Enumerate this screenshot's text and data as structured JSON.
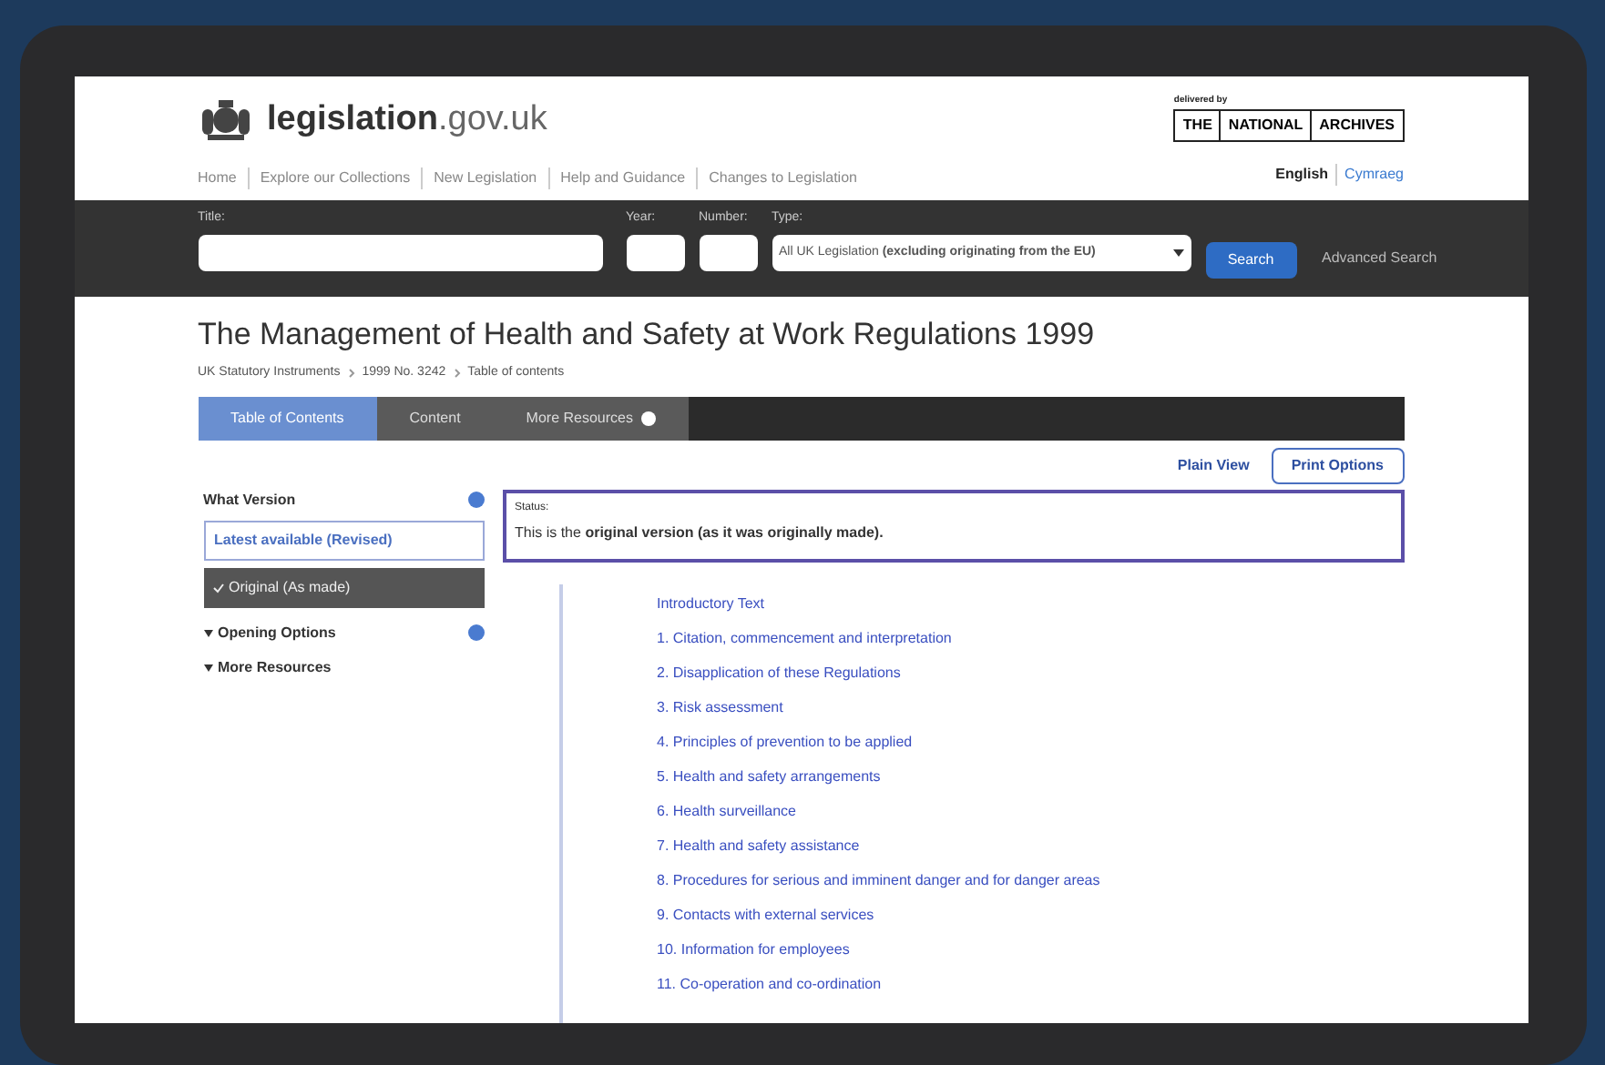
{
  "site": {
    "name": "legislation",
    "domain": ".gov.uk",
    "delivered_by": "delivered by",
    "archives": [
      "THE",
      "NATIONAL",
      "ARCHIVES"
    ]
  },
  "nav": [
    "Home",
    "Explore our Collections",
    "New Legislation",
    "Help and Guidance",
    "Changes to Legislation"
  ],
  "languages": [
    {
      "label": "English",
      "selected": true
    },
    {
      "label": "Cymraeg",
      "selected": false
    }
  ],
  "search": {
    "title_label": "Title:",
    "year_label": "Year:",
    "number_label": "Number:",
    "type_label": "Type:",
    "type_value": "All UK Legislation **(excluding originating from the EU)**",
    "button": "Search",
    "advanced": "Advanced Search"
  },
  "page_title": "The Management of Health and Safety at Work Regulations 1999",
  "breadcrumb": [
    "UK Statutory Instruments",
    "1999 No. 3242",
    "Table of contents"
  ],
  "tabs": [
    {
      "label": "Table of Contents",
      "selected": true,
      "help": false
    },
    {
      "label": "Content",
      "selected": false,
      "help": false
    },
    {
      "label": "More Resources",
      "selected": false,
      "help": true
    }
  ],
  "actions": [
    {
      "label": "Plain View",
      "kind": "link"
    },
    {
      "label": "Print Options",
      "kind": "button"
    }
  ],
  "sidebar": {
    "heading": "What Version",
    "versions": [
      {
        "label": "Latest available (Revised)",
        "selected": false
      },
      {
        "label": "Original (As made)",
        "selected": true
      }
    ],
    "sections": [
      {
        "label": "Opening Options",
        "help": true
      },
      {
        "label": "More Resources",
        "help": false
      }
    ]
  },
  "status": {
    "label": "Status:",
    "text": "This is the **original version (as it was originally made).**"
  },
  "contents": [
    "Introductory Text",
    "1. Citation, commencement and interpretation",
    "2. Disapplication of these Regulations",
    "3. Risk assessment",
    "4. Principles of prevention to be applied",
    "5. Health and safety arrangements",
    "6. Health surveillance",
    "7. Health and safety assistance",
    "8. Procedures for serious and imminent danger and for danger areas",
    "9. Contacts with external services",
    "10. Information for employees",
    "11. Co-operation and co-ordination"
  ]
}
